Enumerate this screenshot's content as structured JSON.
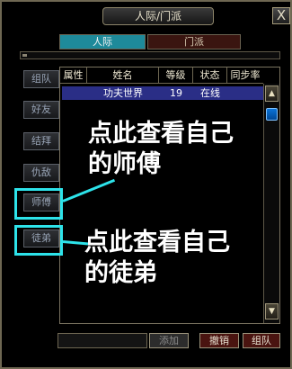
{
  "window": {
    "title": "人际/门派",
    "close_label": "X"
  },
  "tabs": [
    {
      "label": "人际",
      "active": true
    },
    {
      "label": "门派",
      "active": false
    }
  ],
  "sidebar": {
    "items": [
      {
        "label": "组队"
      },
      {
        "label": "好友"
      },
      {
        "label": "结拜"
      },
      {
        "label": "仇敌"
      },
      {
        "label": "师傅"
      },
      {
        "label": "徒弟"
      }
    ]
  },
  "table": {
    "columns": [
      "属性",
      "姓名",
      "等级",
      "状态",
      "同步率"
    ],
    "rows": [
      {
        "attr": "",
        "name": "功夫世界",
        "level": "19",
        "status": "在线",
        "sync": ""
      }
    ]
  },
  "scrollbar": {
    "up_label": "▲",
    "down_label": "▼"
  },
  "annotations": {
    "master": {
      "line1": "点此查看自己",
      "line2": "的师傅"
    },
    "apprentice": {
      "line1": "点此查看自己",
      "line2": "的徒弟"
    }
  },
  "bottom": {
    "search_value": "",
    "buttons": {
      "add": "添加",
      "cancel": "撤销",
      "group": "组队"
    }
  },
  "colors": {
    "callout": "#2de3ea",
    "tab_active": "#1e8a9a",
    "tab_inactive": "#3a1510",
    "selected_row": "#2a2e86"
  }
}
